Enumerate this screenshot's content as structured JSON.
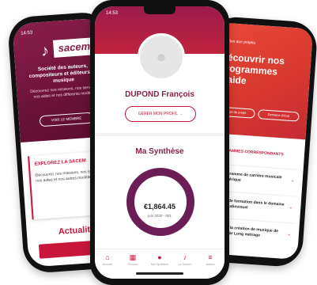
{
  "left_phone": {
    "status_time": "14:53",
    "logo_text": "sacem",
    "tagline": "Société des auteurs, compositeurs et éditeurs de musique",
    "subtitle": "Découvrez nos missions, nos services, nos aides et nos différents modèles",
    "pill": "VOIR LE MEMBRE",
    "card_title": "EXPLOREZ LA SACEM",
    "card_text": "Découvrez nos missions, nos services, nos aides et nos autres modèles",
    "section_title": "Actualité"
  },
  "right_phone": {
    "back_label": "< Aides aux projets",
    "title": "Découvrir nos programmes d'aide",
    "pills": [
      "Type de projet",
      "Domaine d'éval"
    ],
    "section_head": "PROGRAMMES CORRESPONDANTS",
    "items": [
      "Programme de carrière musicale Numérique",
      "Aide de formation dans le domaine de l'audiovisuel",
      "Aide à la création de musique de film - Tar Long métrage"
    ],
    "chevron": "⌄"
  },
  "center_phone": {
    "status_time": "14:53",
    "name": "DUPOND François",
    "profile_button": "GÉRER MON PROFIL  →",
    "synthesis_title": "Ma Synthèse",
    "amount": "€1,864.45",
    "period": "juin 2020 - 001",
    "nav": [
      {
        "icon": "⌂",
        "label": "Accueil"
      },
      {
        "icon": "▦",
        "label": "Œuvres"
      },
      {
        "icon": "●",
        "label": "Ma Synthèse"
      },
      {
        "icon": "♪",
        "label": "Le Sacem"
      },
      {
        "icon": "≡",
        "label": "Autres"
      }
    ]
  },
  "colors": {
    "brand_burgundy": "#8a1f4b",
    "brand_red": "#c8163b",
    "ring_purple": "#6b1e55",
    "orange_red": "#e8493a"
  }
}
